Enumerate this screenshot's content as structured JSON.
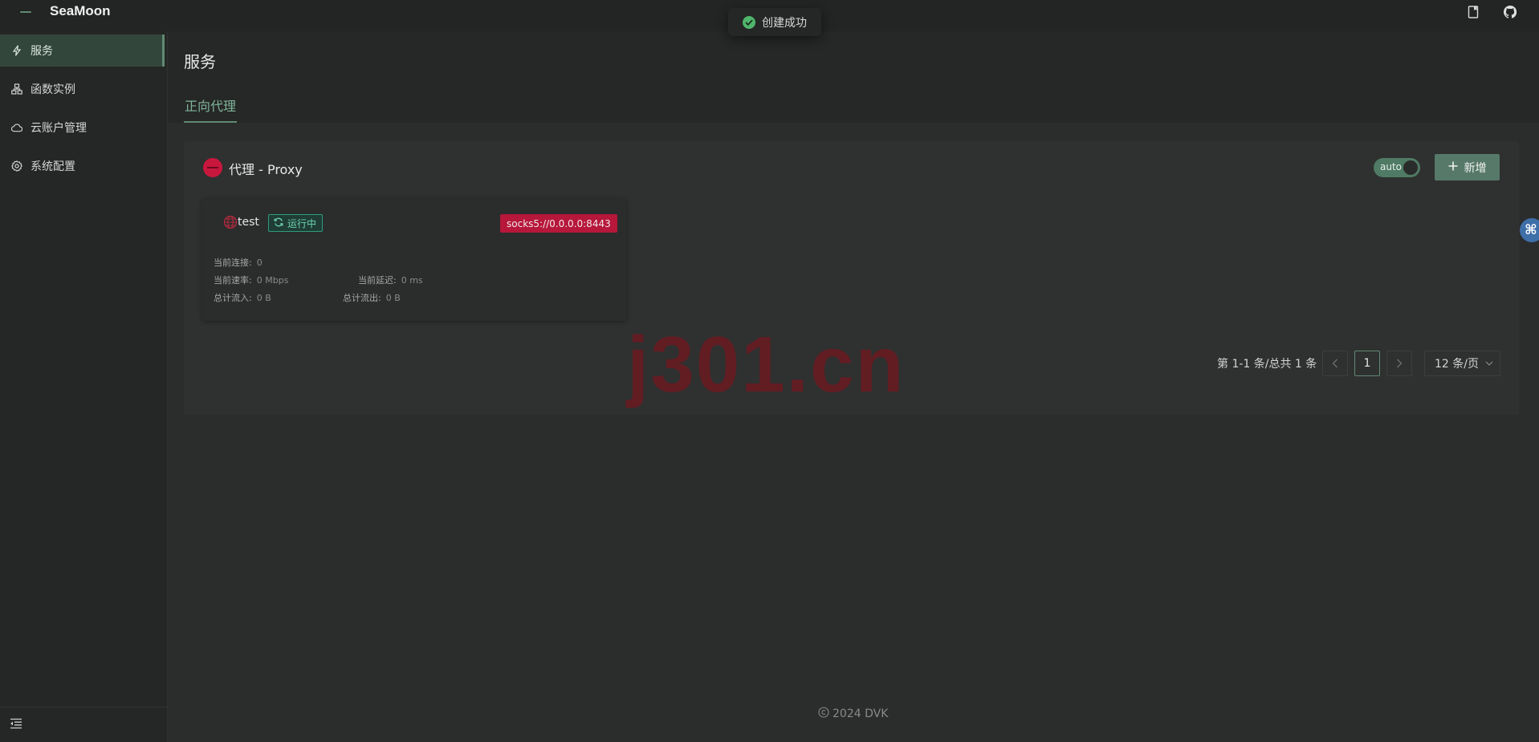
{
  "app": {
    "title": "SeaMoon"
  },
  "toast": {
    "message": "创建成功"
  },
  "sidebar": {
    "items": [
      {
        "label": "服务",
        "icon": "lightning-icon",
        "active": true
      },
      {
        "label": "函数实例",
        "icon": "network-icon",
        "active": false
      },
      {
        "label": "云账户管理",
        "icon": "cloud-icon",
        "active": false
      },
      {
        "label": "系统配置",
        "icon": "gear-icon",
        "active": false
      }
    ]
  },
  "page": {
    "title": "服务",
    "tabs": [
      {
        "label": "正向代理",
        "active": true
      }
    ]
  },
  "card": {
    "title": "代理 - Proxy",
    "toggle_label": "auto",
    "add_label": "新增",
    "item": {
      "name": "test",
      "status": "运行中",
      "address": "socks5://0.0.0.0:8443",
      "stats": {
        "connections_label": "当前连接:",
        "connections_value": "0",
        "rate_label": "当前速率:",
        "rate_value": "0 Mbps",
        "latency_label": "当前延迟:",
        "latency_value": "0 ms",
        "in_label": "总计流入:",
        "in_value": "0 B",
        "out_label": "总计流出:",
        "out_value": "0 B"
      }
    }
  },
  "pagination": {
    "total_text": "第 1-1 条/总共 1 条",
    "current_page": "1",
    "page_size": "12 条/页"
  },
  "watermark": "j301.cn",
  "footer": {
    "text": "2024 DVK"
  },
  "edge_button": {
    "symbol": "⌘"
  },
  "colors": {
    "accent": "#5f8a73",
    "status_running": "#2f9c7c",
    "address_tag": "#b6173a",
    "success": "#4fb56b"
  }
}
